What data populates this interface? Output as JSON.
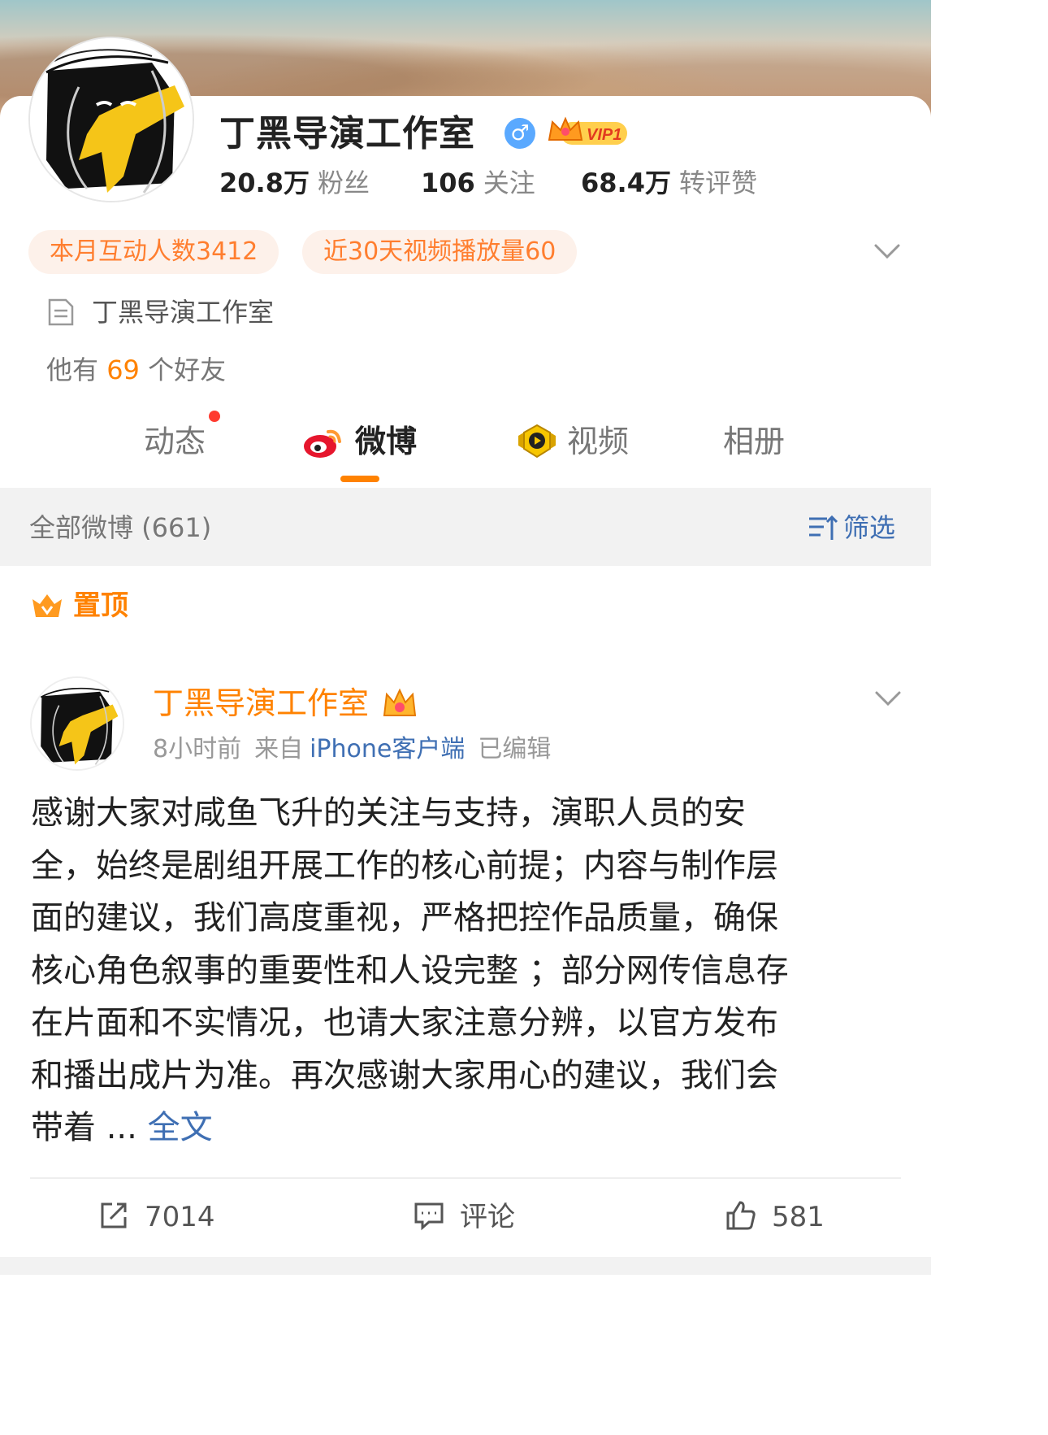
{
  "profile": {
    "name": "丁黑导演工作室",
    "vip": "VIP1",
    "stats": [
      {
        "num": "20.8万",
        "label": "粉丝"
      },
      {
        "num": "106",
        "label": "关注"
      },
      {
        "num": "68.4万",
        "label": "转评赞"
      }
    ],
    "pills": [
      "本月互动人数3412",
      "近30天视频播放量60"
    ],
    "bio": "丁黑导演工作室",
    "friends": {
      "prefix": "他有",
      "count": "69",
      "suffix": "个好友"
    }
  },
  "tabs": [
    {
      "label": "动态",
      "has_dot": true
    },
    {
      "label": "微博",
      "active": true
    },
    {
      "label": "视频"
    },
    {
      "label": "相册"
    }
  ],
  "filter": {
    "title": "全部微博 (661)",
    "button": "筛选"
  },
  "pinned_label": "置顶",
  "post": {
    "author": "丁黑导演工作室",
    "time": "8小时前",
    "from_prefix": "来自",
    "source": "iPhone客户端",
    "edited": "已编辑",
    "body_lines": [
      "感谢大家对咸鱼飞升的关注与支持，演职人员的安",
      "全，始终是剧组开展工作的核心前提；内容与制作层",
      "面的建议，我们高度重视，严格把控作品质量，确保",
      "核心角色叙事的重要性和人设完整 ；部分网传信息存",
      "在片面和不实情况，也请大家注意分辨，以官方发布",
      "和播出成片为准。再次感谢大家用心的建议，我们会",
      "带着 ..."
    ],
    "read_more": "全文",
    "actions": {
      "repost": "7014",
      "comment": "评论",
      "like": "581"
    }
  },
  "colors": {
    "accent": "#ff8200",
    "link": "#3f6fb3",
    "gray_bg": "#f2f2f2"
  }
}
